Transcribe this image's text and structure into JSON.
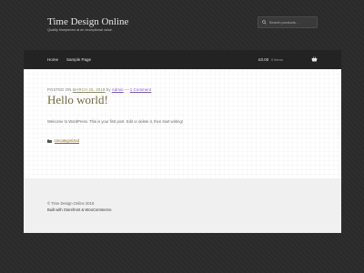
{
  "header": {
    "site_title": "Time Design Online",
    "tagline": "Quality timepieces at an exceptional value.",
    "search_placeholder": "Search products…"
  },
  "nav": {
    "items": [
      {
        "label": "Home"
      },
      {
        "label": "Sample Page"
      }
    ],
    "cart_total": "£0.00",
    "cart_count": "0 items"
  },
  "post": {
    "meta_prefix": "POSTED ON",
    "date": "MARCH 26, 2019",
    "by": "by",
    "author": "Admin",
    "separator": "—",
    "comments": "1 Comment",
    "title": "Hello world!",
    "body": "Welcome to WordPress. This is your first post. Edit or delete it, then start writing!",
    "category": "Uncategorized"
  },
  "footer": {
    "copyright": "© Time Design Online 2019",
    "built_with": "Built with Storefront & WooCommerce."
  }
}
